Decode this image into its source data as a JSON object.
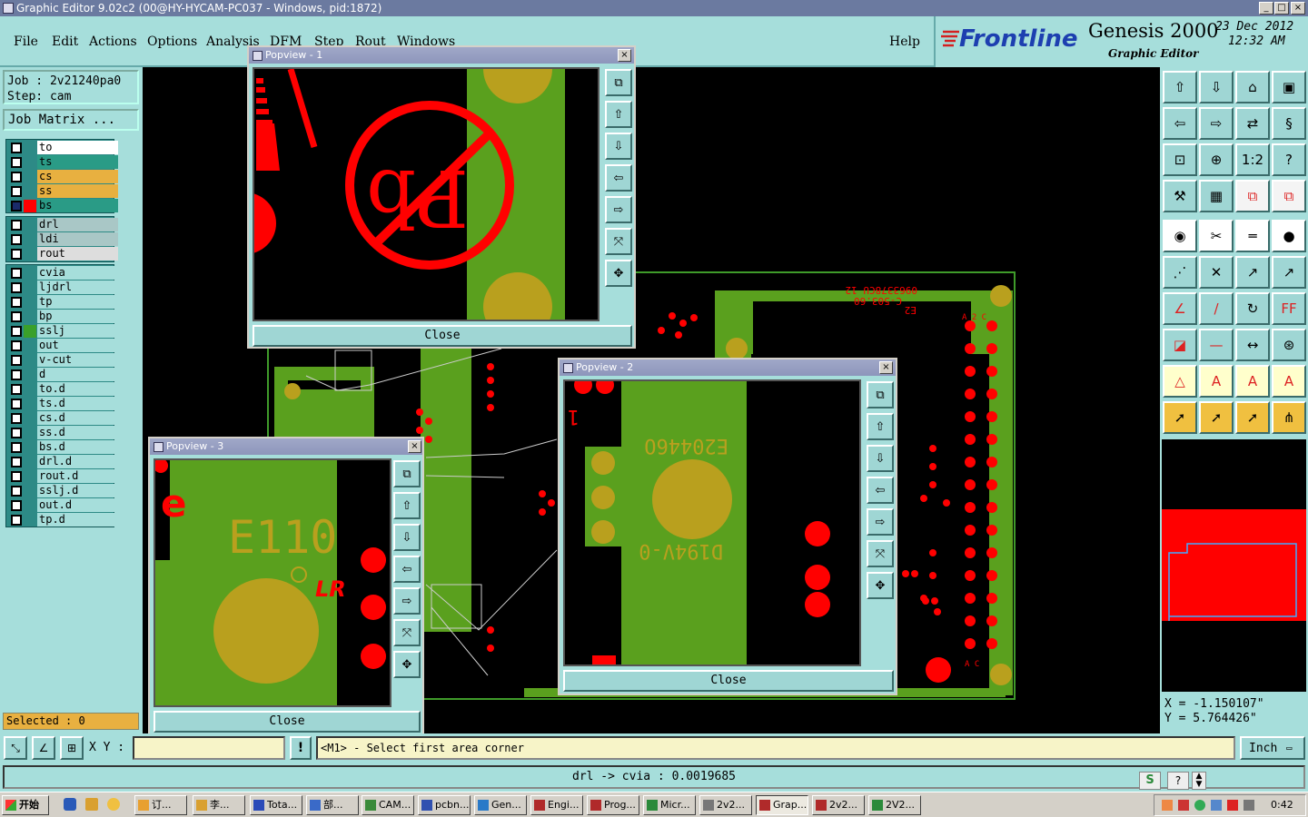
{
  "window": {
    "title": "Graphic Editor 9.02c2 (00@HY-HYCAM-PC037 - Windows, pid:1872)",
    "min": "_",
    "max": "□",
    "close": "×"
  },
  "menu": [
    "File",
    "Edit",
    "Actions",
    "Options",
    "Analysis",
    "DFM",
    "Step",
    "Rout",
    "Windows"
  ],
  "help": "Help",
  "brand": {
    "logo": "Frontline",
    "product": "Genesis 2000",
    "subtitle": "Graphic Editor",
    "date": "23 Dec 2012",
    "time": "12:32 AM"
  },
  "job": {
    "job": "Job : 2v21240pa0",
    "step": "Step: cam",
    "matrix_button": "Job Matrix ..."
  },
  "layers_group1": [
    {
      "name": "to",
      "color": "#ffffff"
    },
    {
      "name": "ts",
      "color": "#2a9b86"
    },
    {
      "name": "cs",
      "color": "#e8b040"
    },
    {
      "name": "ss",
      "color": "#e8b040"
    },
    {
      "name": "bs",
      "color": "#2a9b86"
    }
  ],
  "layers_group2": [
    "drl",
    "ldi",
    "rout"
  ],
  "layers_group3": [
    "cvia",
    "ljdrl",
    "tp",
    "bp",
    "sslj",
    "out",
    "v-cut",
    "d",
    "to.d",
    "ts.d",
    "cs.d",
    "ss.d",
    "bs.d",
    "drl.d",
    "rout.d",
    "sslj.d",
    "out.d",
    "tp.d"
  ],
  "selected": "Selected : 0",
  "popups": [
    {
      "title": "Popview - 1",
      "close": "Close"
    },
    {
      "title": "Popview - 2",
      "close": "Close",
      "text1": "E20446O",
      "text2": "D194V-0",
      "mark": "1"
    },
    {
      "title": "Popview - 3",
      "close": "Close",
      "text1": "E110",
      "text2": "LR"
    }
  ],
  "coords": {
    "x": "X = -1.150107\"",
    "y": "Y = 5.764426\""
  },
  "status": {
    "xy_label": "X Y :",
    "xy_value": "",
    "bang": "!",
    "prompt": "<M1> - Select first area corner",
    "units": "Inch"
  },
  "message": "drl -> cvia : 0.0019685",
  "taskbar": {
    "start": "开始",
    "tasks": [
      "订...",
      "李...",
      "Tota...",
      "部...",
      "CAM...",
      "pcbn...",
      "Gen...",
      "Engi...",
      "Prog...",
      "Micr...",
      "2v2...",
      "Grap...",
      "2v2...",
      "2V2..."
    ],
    "clock": "0:42"
  },
  "canvas_text": [
    "0963378CU 12",
    "C-503.60",
    "E2",
    "A 2 C",
    "A C"
  ]
}
